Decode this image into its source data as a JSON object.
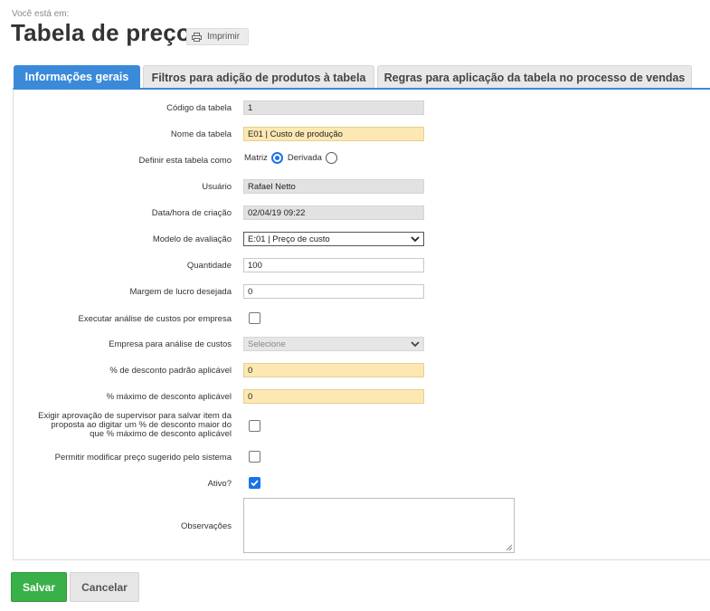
{
  "breadcrumb": "Você está em:",
  "page_title": "Tabela de preço",
  "print_label": "Imprimir",
  "tabs": [
    {
      "label": "Informações gerais",
      "active": true
    },
    {
      "label": "Filtros para adição de produtos à tabela",
      "active": false
    },
    {
      "label": "Regras para aplicação da tabela no processo de vendas",
      "active": false
    }
  ],
  "form": {
    "codigo": {
      "label": "Código da tabela",
      "value": "1"
    },
    "nome": {
      "label": "Nome da tabela",
      "value": "E01 | Custo de produção"
    },
    "definir": {
      "label": "Definir esta tabela como",
      "opt1": "Matriz",
      "opt2": "Derivada",
      "selected": "Matriz"
    },
    "usuario": {
      "label": "Usuário",
      "value": "Rafael Netto"
    },
    "data": {
      "label": "Data/hora de criação",
      "value": "02/04/19 09:22"
    },
    "modelo": {
      "label": "Modelo de avaliação",
      "value": "E:01 | Preço de custo"
    },
    "quantidade": {
      "label": "Quantidade",
      "value": "100"
    },
    "margem": {
      "label": "Margem de lucro desejada",
      "value": "0"
    },
    "executar": {
      "label": "Executar análise de custos por empresa",
      "checked": false
    },
    "empresa": {
      "label": "Empresa para análise de custos",
      "value": "Selecione"
    },
    "desconto_padrao": {
      "label": "% de desconto padrão aplicável",
      "value": "0"
    },
    "desconto_max": {
      "label": "% máximo de desconto aplicável",
      "value": "0"
    },
    "exigir": {
      "label": "Exigir aprovação de supervisor para salvar item da proposta ao digitar um % de desconto maior do que % máximo de desconto aplicável",
      "checked": false
    },
    "permitir": {
      "label": "Permitir modificar preço sugerido pelo sistema",
      "checked": false
    },
    "ativo": {
      "label": "Ativo?",
      "checked": true
    },
    "observacoes": {
      "label": "Observações",
      "value": ""
    }
  },
  "buttons": {
    "save": "Salvar",
    "cancel": "Cancelar"
  },
  "colors": {
    "accent": "#3a8ad9",
    "save": "#3ab049",
    "highlight": "#fde8b3"
  }
}
